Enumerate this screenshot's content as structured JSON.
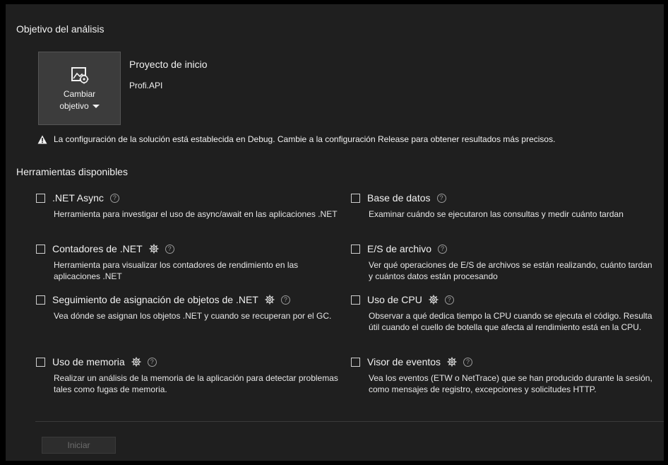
{
  "target_section": {
    "title": "Objetivo del análisis",
    "change_target_line1": "Cambiar",
    "change_target_line2": "objetivo",
    "startup_project_heading": "Proyecto de inicio",
    "startup_project_name": "Profi.API"
  },
  "warning": {
    "icon": "warning-icon",
    "text": "La configuración de la solución está establecida en Debug. Cambie a la configuración Release para obtener resultados más precisos."
  },
  "tools_section": {
    "title": "Herramientas disponibles",
    "tools": [
      {
        "name": ".NET Async",
        "has_settings": false,
        "checked": false,
        "description": "Herramienta para investigar el uso de async/await en las aplicaciones .NET"
      },
      {
        "name": "Base de datos",
        "has_settings": false,
        "checked": false,
        "description": "Examinar cuándo se ejecutaron las consultas y medir cuánto tardan"
      },
      {
        "name": "Contadores de .NET",
        "has_settings": true,
        "checked": false,
        "description": "Herramienta para visualizar los contadores de rendimiento en las aplicaciones .NET"
      },
      {
        "name": "E/S de archivo",
        "has_settings": false,
        "checked": false,
        "description": "Ver qué operaciones de E/S de archivos se están realizando, cuánto tardan y cuántos datos están procesando"
      },
      {
        "name": "Seguimiento de asignación de objetos de .NET",
        "has_settings": true,
        "checked": false,
        "description": "Vea dónde se asignan los objetos .NET y cuando se recuperan por el GC."
      },
      {
        "name": "Uso de CPU",
        "has_settings": true,
        "checked": false,
        "description": "Observar a qué dedica tiempo la CPU cuando se ejecuta el código. Resulta útil cuando el cuello de botella que afecta al rendimiento está en la CPU."
      },
      {
        "name": "Uso de memoria",
        "has_settings": true,
        "checked": false,
        "description": "Realizar un análisis de la memoria de la aplicación para detectar problemas tales como fugas de memoria."
      },
      {
        "name": "Visor de eventos",
        "has_settings": true,
        "checked": false,
        "description": "Vea los eventos (ETW o NetTrace) que se han producido durante la sesión, como mensajes de registro, excepciones y solicitudes HTTP."
      }
    ]
  },
  "start_button": {
    "label": "Iniciar",
    "enabled": false
  },
  "colors": {
    "background": "#1f1f1f",
    "outer": "#000000",
    "text": "#f1f1f1",
    "button": "#3c3c3c",
    "disabled_text": "#6d6d6d"
  }
}
